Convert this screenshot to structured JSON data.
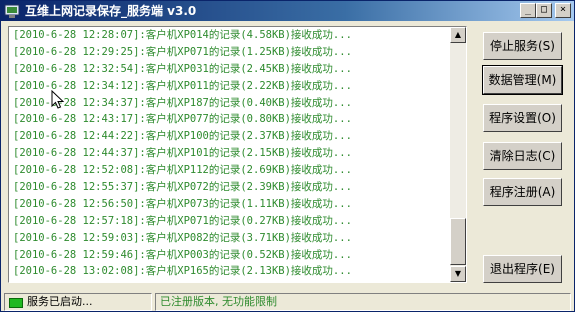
{
  "window": {
    "title": "互维上网记录保存_服务端 v3.0",
    "controls": {
      "minimize": "_",
      "maximize": "□",
      "close": "×"
    }
  },
  "log": {
    "lines": [
      "[2010-6-28 12:28:07]:客户机XP014的记录(4.58KB)接收成功...",
      "[2010-6-28 12:29:25]:客户机XP071的记录(1.25KB)接收成功...",
      "[2010-6-28 12:32:54]:客户机XP031的记录(2.45KB)接收成功...",
      "[2010-6-28 12:34:12]:客户机XP011的记录(2.22KB)接收成功...",
      "[2010-6-28 12:34:37]:客户机XP187的记录(0.40KB)接收成功...",
      "[2010-6-28 12:43:17]:客户机XP077的记录(0.80KB)接收成功...",
      "[2010-6-28 12:44:22]:客户机XP100的记录(2.37KB)接收成功...",
      "[2010-6-28 12:44:37]:客户机XP101的记录(2.15KB)接收成功...",
      "[2010-6-28 12:52:08]:客户机XP112的记录(2.69KB)接收成功...",
      "[2010-6-28 12:55:37]:客户机XP072的记录(2.39KB)接收成功...",
      "[2010-6-28 12:56:50]:客户机XP073的记录(1.11KB)接收成功...",
      "[2010-6-28 12:57:18]:客户机XP071的记录(0.27KB)接收成功...",
      "[2010-6-28 12:59:03]:客户机XP082的记录(3.71KB)接收成功...",
      "[2010-6-28 12:59:46]:客户机XP003的记录(0.52KB)接收成功...",
      "[2010-6-28 13:02:08]:客户机XP165的记录(2.13KB)接收成功..."
    ]
  },
  "buttons": {
    "stop_service": "停止服务(S)",
    "data_manage": "数据管理(M)",
    "program_settings": "程序设置(O)",
    "clear_log": "清除日志(C)",
    "program_register": "程序注册(A)",
    "exit_program": "退出程序(E)"
  },
  "status": {
    "service": "服务已启动...",
    "license": "已注册版本, 无功能限制"
  },
  "colors": {
    "log_text": "#2e8b2e",
    "title_bar": "#0a246a",
    "status_led": "#21b821"
  },
  "icons": {
    "app": "app-icon",
    "cursor": "mouse-cursor-icon"
  }
}
